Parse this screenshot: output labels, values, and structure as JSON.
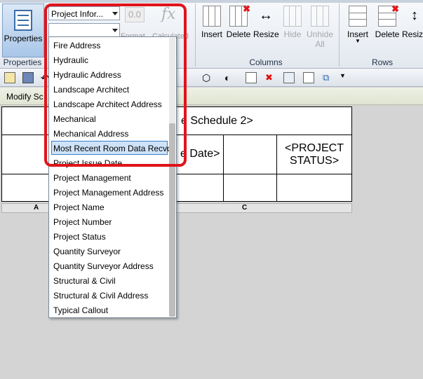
{
  "ribbon": {
    "properties_label": "Properties",
    "properties_panel": "Properties",
    "parameter_combo": "Project Infor...",
    "value_combo": "",
    "format_label": "Format",
    "calculated_label": "Calculated",
    "columns_panel": "Columns",
    "rows_panel": "Rows",
    "col_buttons": [
      "Insert",
      "Delete",
      "Resize",
      "Hide",
      "Unhide All"
    ],
    "row_buttons": [
      "Insert",
      "Delete",
      "Resize"
    ]
  },
  "modify_bar": {
    "label": "Modify Sc"
  },
  "schedule": {
    "title": "e Schedule 2>",
    "issue_date": "e Date>",
    "project_status": "<PROJECT STATUS>",
    "col_a": "A",
    "col_c": "C"
  },
  "dropdown": {
    "items": [
      "Fire Address",
      "Hydraulic",
      "Hydraulic Address",
      "Landscape Architect",
      "Landscape Architect Address",
      "Mechanical",
      "Mechanical Address",
      "Most Recent Room Data Recvd",
      "Project Issue Date",
      "Project Management",
      "Project Management Address",
      "Project Name",
      "Project Number",
      "Project Status",
      "Quantity Surveyor",
      "Quantity Surveyor Address",
      "Structural & Civil",
      "Structural & Civil Address",
      "Typical Callout"
    ],
    "selected_index": 7
  },
  "colors": {
    "highlight": "#e0141b",
    "selection": "#cfe3f8"
  }
}
